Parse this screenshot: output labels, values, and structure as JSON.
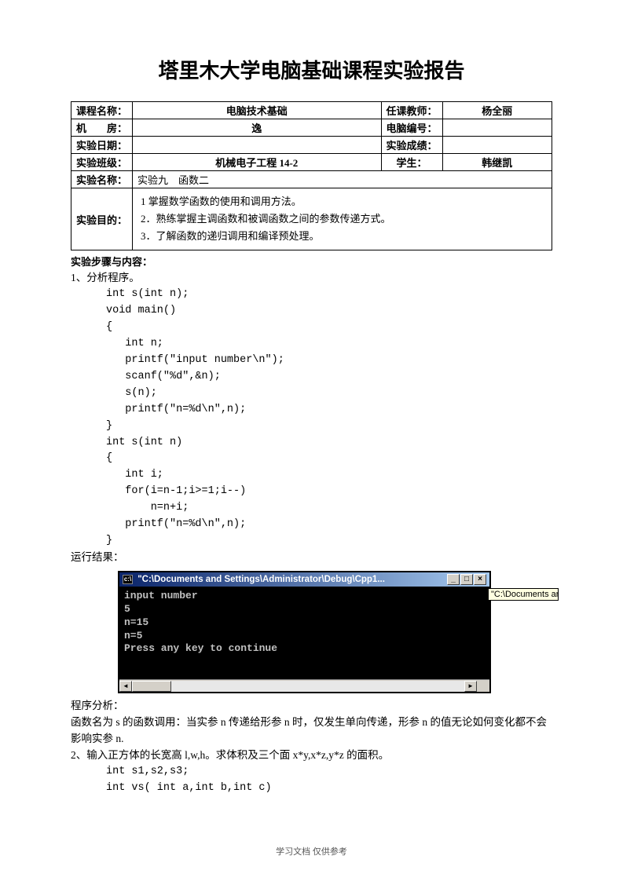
{
  "title": "塔里木大学电脑基础课程实验报告",
  "table": {
    "r1": {
      "c1": "课程名称：",
      "c2": "电脑技术基础",
      "c3": "任课教师：",
      "c4": "杨全丽"
    },
    "r2": {
      "c1": "机　　房：",
      "c2": "逸",
      "c3": "电脑编号：",
      "c4": ""
    },
    "r3": {
      "c1": "实验日期：",
      "c2": "",
      "c3": "实验成绩：",
      "c4": ""
    },
    "r4": {
      "c1": "实验班级：",
      "c2": "机械电子工程 14-2",
      "c3": "学生：",
      "c4": "韩继凯"
    },
    "r5": {
      "c1": "实验名称：",
      "c2": "实验九　函数二"
    },
    "r6": {
      "c1": "实验目的：",
      "p1": "1 掌握数学函数的使用和调用方法。",
      "p2": "2．熟练掌握主调函数和被调函数之间的参数传递方式。",
      "p3": "3．了解函数的递归调用和编译预处理。"
    }
  },
  "steps_label": "实验步骤与内容：",
  "q1_label": "1、分析程序。",
  "code1": "int s(int n);\nvoid main()\n{\n   int n;\n   printf(\"input number\\n\");\n   scanf(\"%d\",&n);\n   s(n);\n   printf(\"n=%d\\n\",n);\n}\nint s(int n)\n{\n   int i;\n   for(i=n-1;i>=1;i--)\n       n=n+i;\n   printf(\"n=%d\\n\",n);\n}",
  "run_label": "运行结果：",
  "console": {
    "title": "\"C:\\Documents and Settings\\Administrator\\Debug\\Cpp1...",
    "tooltip": "\"C:\\Documents ar",
    "lines": "input number\n5\nn=15\nn=5\nPress any key to continue",
    "btn_min": "_",
    "btn_max": "□",
    "btn_close": "×",
    "arrow_l": "◄",
    "arrow_r": "►"
  },
  "analysis_label": "程序分析：",
  "analysis_text": "函数名为 s 的函数调用：当实参 n 传递给形参 n 时，仅发生单向传递，形参 n 的值无论如何变化都不会影响实参 n.",
  "q2_label": "2、输入正方体的长宽高 l,w,h。求体积及三个面 x*y,x*z,y*z 的面积。",
  "code2": "int s1,s2,s3;\nint vs( int a,int b,int c)",
  "footer": "学习文档 仅供参考",
  "chart_data": null
}
